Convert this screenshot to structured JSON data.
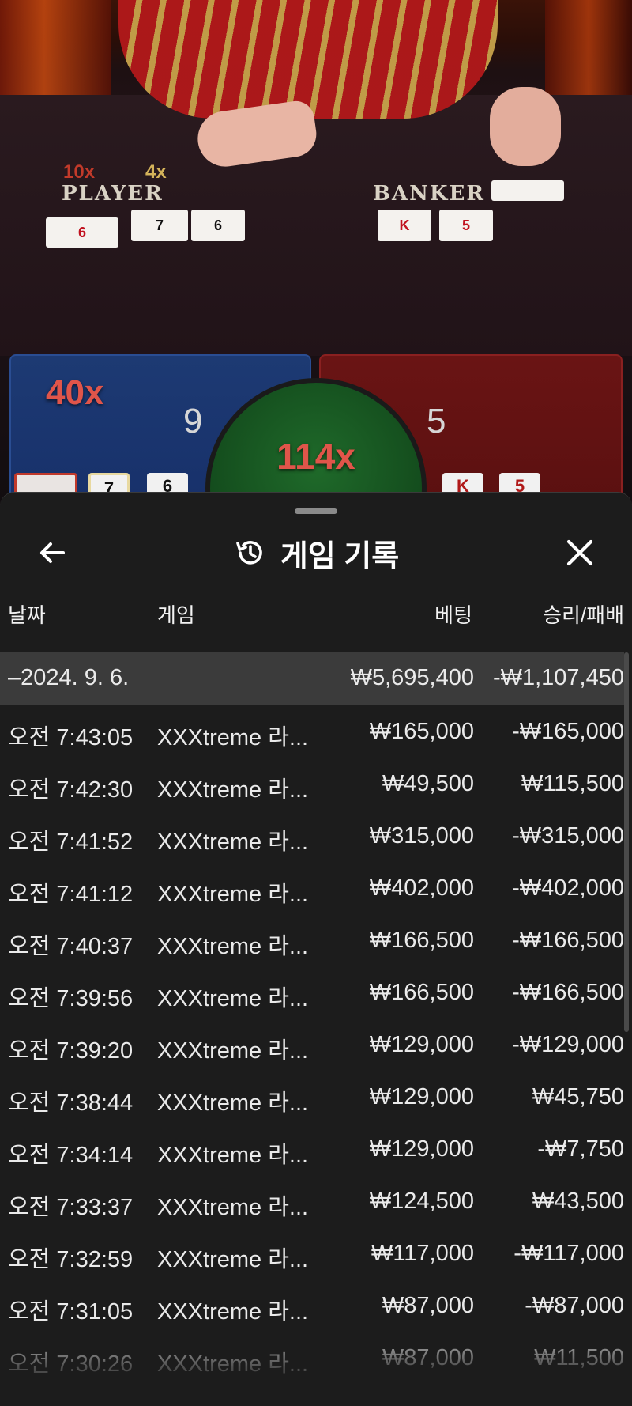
{
  "video": {
    "player_label": "PLAYER",
    "banker_label": "BANKER",
    "player_mult_top": "10x",
    "player_mult_top2": "4x",
    "player_cards": [
      "6",
      "7",
      "6"
    ],
    "banker_cards": [
      "K",
      "5"
    ],
    "player_spot_mult": "40x",
    "player_score": "9",
    "banker_score": "5",
    "tie_mult": "114x",
    "result_cards_player": [
      "7",
      "6"
    ],
    "result_cards_banker": [
      "K",
      "5"
    ]
  },
  "sheet": {
    "title": "게임 기록",
    "back_icon": "arrow-left-icon",
    "history_icon": "history-clock-icon",
    "close_icon": "close-x-icon"
  },
  "columns": {
    "date": "날짜",
    "game": "게임",
    "bet": "베팅",
    "win_loss": "승리/패배"
  },
  "date_group": {
    "date": "–2024. 9. 6.",
    "bet": "₩5,695,400",
    "win_loss": "-₩1,107,450"
  },
  "rows": [
    {
      "time": "오전 7:43:05",
      "game": "XXXtreme 라...",
      "bet": "₩165,000",
      "win_loss": "-₩165,000"
    },
    {
      "time": "오전 7:42:30",
      "game": "XXXtreme 라...",
      "bet": "₩49,500",
      "win_loss": "₩115,500"
    },
    {
      "time": "오전 7:41:52",
      "game": "XXXtreme 라...",
      "bet": "₩315,000",
      "win_loss": "-₩315,000"
    },
    {
      "time": "오전 7:41:12",
      "game": "XXXtreme 라...",
      "bet": "₩402,000",
      "win_loss": "-₩402,000"
    },
    {
      "time": "오전 7:40:37",
      "game": "XXXtreme 라...",
      "bet": "₩166,500",
      "win_loss": "-₩166,500"
    },
    {
      "time": "오전 7:39:56",
      "game": "XXXtreme 라...",
      "bet": "₩166,500",
      "win_loss": "-₩166,500"
    },
    {
      "time": "오전 7:39:20",
      "game": "XXXtreme 라...",
      "bet": "₩129,000",
      "win_loss": "-₩129,000"
    },
    {
      "time": "오전 7:38:44",
      "game": "XXXtreme 라...",
      "bet": "₩129,000",
      "win_loss": "₩45,750"
    },
    {
      "time": "오전 7:34:14",
      "game": "XXXtreme 라...",
      "bet": "₩129,000",
      "win_loss": "-₩7,750"
    },
    {
      "time": "오전 7:33:37",
      "game": "XXXtreme 라...",
      "bet": "₩124,500",
      "win_loss": "₩43,500"
    },
    {
      "time": "오전 7:32:59",
      "game": "XXXtreme 라...",
      "bet": "₩117,000",
      "win_loss": "-₩117,000"
    },
    {
      "time": "오전 7:31:05",
      "game": "XXXtreme 라...",
      "bet": "₩87,000",
      "win_loss": "-₩87,000"
    },
    {
      "time": "오전 7:30:26",
      "game": "XXXtreme 라...",
      "bet": "₩87,000",
      "win_loss": "₩11,500"
    }
  ],
  "colors": {
    "sheet_bg": "#1c1c1c",
    "date_row_bg": "#3b3b3b",
    "player_blue": "#1d3a73",
    "banker_red": "#6a1414",
    "tie_green": "#1f6a2a"
  }
}
